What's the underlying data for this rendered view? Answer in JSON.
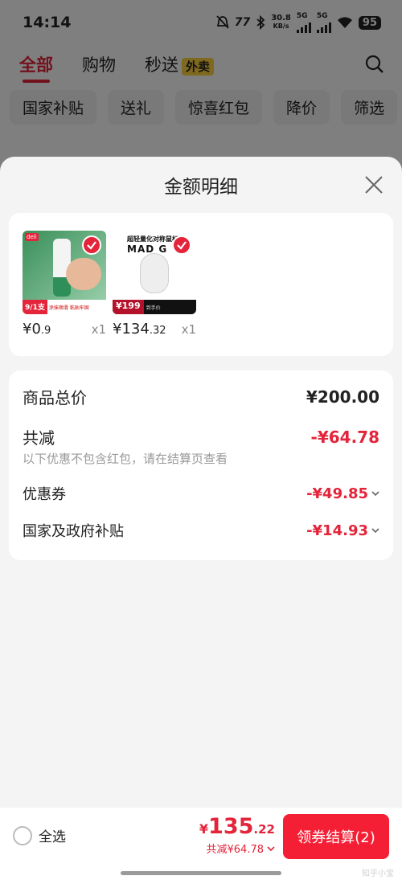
{
  "status_bar": {
    "time": "14:14",
    "network_speed": "30.8",
    "network_unit": "KB/s",
    "sim1": "5G",
    "sim2": "5G",
    "battery": "95"
  },
  "top_tabs": [
    {
      "label": "全部",
      "active": true
    },
    {
      "label": "购物",
      "active": false
    },
    {
      "label": "秒送",
      "active": false,
      "badge": "外卖"
    }
  ],
  "filter_chips": [
    "国家补贴",
    "送礼",
    "惊喜红包",
    "降价",
    "筛选"
  ],
  "sheet": {
    "title": "金额明细",
    "products": [
      {
        "price_int": "¥0",
        "price_dec": ".9",
        "qty": "x1",
        "image": "glue-stick-product",
        "promo": "9",
        "promo_unit": "1支",
        "caption": "涂抹顺滑 粘贴牢固",
        "brand": "deli"
      },
      {
        "price_int": "¥134",
        "price_dec": ".32",
        "qty": "x1",
        "image": "mouse-product",
        "headline": "超轻量化对称鼠标",
        "brand": "MAD G",
        "promo": "199",
        "promo_label": "到手价"
      }
    ],
    "summary": {
      "goods_total_label": "商品总价",
      "goods_total_value": "¥200.00",
      "discount_label": "共减",
      "discount_value": "-¥64.78",
      "note": "以下优惠不包含红包，请在结算页查看",
      "coupon_label": "优惠券",
      "coupon_value": "-¥49.85",
      "subsidy_label": "国家及政府补贴",
      "subsidy_value": "-¥14.93"
    }
  },
  "bottom_bar": {
    "select_all_label": "全选",
    "currency": "¥",
    "total_int": "135",
    "total_dec": ".22",
    "saved_text": "共减¥64.78",
    "checkout_label": "领券结算(2)"
  },
  "watermark": "知乎小宝",
  "colors": {
    "accent": "#e4243a",
    "button": "#f41e35",
    "badge_yellow": "#ffd23f"
  }
}
